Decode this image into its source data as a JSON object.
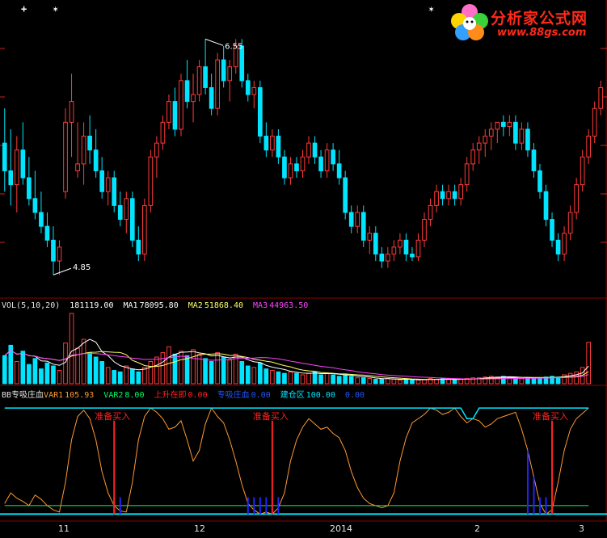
{
  "colors": {
    "up": "#ff3b3b",
    "down": "#00e5ff",
    "grid": "#8b0000",
    "ma1": "#ffffff",
    "ma2": "#ffff66",
    "ma3": "#ff44ff",
    "var1": "#ff9933",
    "var2": "#00ff66",
    "rise": "#ff2222",
    "absorb": "#2222ff",
    "build": "#00e5ff",
    "white": "#ffffff"
  },
  "logo": {
    "title": "分析家公式网",
    "url": "www.88gs.com"
  },
  "markers": {
    "cross": "+",
    "star": "✶"
  },
  "vol_legend": {
    "name": "VOL(5,10,20)",
    "vol": "181119.00",
    "ma1_label": "MA1",
    "ma1_value": "78095.80",
    "ma2_label": "MA2",
    "ma2_value": "51868.40",
    "ma3_label": "MA3",
    "ma3_value": "44963.50"
  },
  "ind_legend": {
    "name": "BB专吸庄血",
    "var1_label": "VAR1",
    "var1_value": "105.93",
    "var2_label": "VAR2",
    "var2_value": "8.00",
    "rise_label": "上升在即",
    "rise_value": "0.00",
    "absorb_label": "专吸庄血",
    "absorb_value": "0.00",
    "build_label": "建仓区",
    "build_value": "100.00",
    "extra_value": "0.00"
  },
  "signal_text": "准备买入",
  "chart_data": [
    {
      "type": "candlestick",
      "title": "",
      "annotations": [
        "6.55",
        "4.85"
      ],
      "high_label": "6.55",
      "low_label": "4.85",
      "ylim": [
        4.7,
        6.75
      ],
      "x_ticks": [
        "11",
        "12",
        "2014",
        "2",
        "3"
      ],
      "candles": [
        [
          5.8,
          6.05,
          5.45,
          5.6
        ],
        [
          5.6,
          5.9,
          5.35,
          5.5
        ],
        [
          5.5,
          5.85,
          5.3,
          5.75
        ],
        [
          5.75,
          5.95,
          5.5,
          5.55
        ],
        [
          5.55,
          5.7,
          5.35,
          5.4
        ],
        [
          5.4,
          5.6,
          5.25,
          5.3
        ],
        [
          5.3,
          5.45,
          5.15,
          5.2
        ],
        [
          5.2,
          5.3,
          5.05,
          5.1
        ],
        [
          5.1,
          5.2,
          4.85,
          4.95
        ],
        [
          4.95,
          5.1,
          4.85,
          5.05
        ],
        [
          5.45,
          6.05,
          5.4,
          5.95
        ],
        [
          5.95,
          6.3,
          5.7,
          6.1
        ],
        [
          5.6,
          5.95,
          5.55,
          5.65
        ],
        [
          5.65,
          5.95,
          5.5,
          5.85
        ],
        [
          5.85,
          6.0,
          5.65,
          5.75
        ],
        [
          5.75,
          5.9,
          5.55,
          5.6
        ],
        [
          5.6,
          5.7,
          5.4,
          5.45
        ],
        [
          5.45,
          5.6,
          5.35,
          5.55
        ],
        [
          5.55,
          5.6,
          5.3,
          5.35
        ],
        [
          5.35,
          5.45,
          5.2,
          5.25
        ],
        [
          5.25,
          5.45,
          5.15,
          5.4
        ],
        [
          5.4,
          5.45,
          5.05,
          5.1
        ],
        [
          5.1,
          5.2,
          4.95,
          5.0
        ],
        [
          5.0,
          5.4,
          4.95,
          5.35
        ],
        [
          5.35,
          5.75,
          5.3,
          5.7
        ],
        [
          5.7,
          5.85,
          5.55,
          5.8
        ],
        [
          5.8,
          6.0,
          5.75,
          5.95
        ],
        [
          5.95,
          6.15,
          5.9,
          6.1
        ],
        [
          6.1,
          6.2,
          5.85,
          5.9
        ],
        [
          5.9,
          6.3,
          5.85,
          6.25
        ],
        [
          6.25,
          6.4,
          6.05,
          6.1
        ],
        [
          6.1,
          6.3,
          5.95,
          6.15
        ],
        [
          6.15,
          6.4,
          6.1,
          6.35
        ],
        [
          6.35,
          6.55,
          6.15,
          6.2
        ],
        [
          6.2,
          6.3,
          6.0,
          6.05
        ],
        [
          6.05,
          6.45,
          6.0,
          6.4
        ],
        [
          6.4,
          6.5,
          6.2,
          6.25
        ],
        [
          6.25,
          6.4,
          6.1,
          6.35
        ],
        [
          6.35,
          6.55,
          6.3,
          6.5
        ],
        [
          6.5,
          6.55,
          6.2,
          6.25
        ],
        [
          6.25,
          6.3,
          6.1,
          6.15
        ],
        [
          6.15,
          6.25,
          6.05,
          6.2
        ],
        [
          6.2,
          6.25,
          5.8,
          5.85
        ],
        [
          5.85,
          5.95,
          5.7,
          5.75
        ],
        [
          5.75,
          5.9,
          5.7,
          5.85
        ],
        [
          5.85,
          5.9,
          5.65,
          5.7
        ],
        [
          5.7,
          5.75,
          5.5,
          5.55
        ],
        [
          5.55,
          5.7,
          5.5,
          5.65
        ],
        [
          5.65,
          5.7,
          5.55,
          5.6
        ],
        [
          5.6,
          5.75,
          5.55,
          5.7
        ],
        [
          5.7,
          5.85,
          5.65,
          5.8
        ],
        [
          5.8,
          5.85,
          5.65,
          5.7
        ],
        [
          5.7,
          5.75,
          5.55,
          5.6
        ],
        [
          5.6,
          5.8,
          5.55,
          5.75
        ],
        [
          5.75,
          5.8,
          5.6,
          5.65
        ],
        [
          5.65,
          5.75,
          5.5,
          5.55
        ],
        [
          5.55,
          5.6,
          5.25,
          5.3
        ],
        [
          5.3,
          5.35,
          5.15,
          5.2
        ],
        [
          5.2,
          5.35,
          5.15,
          5.3
        ],
        [
          5.3,
          5.35,
          5.05,
          5.1
        ],
        [
          5.1,
          5.2,
          5.0,
          5.15
        ],
        [
          5.15,
          5.2,
          4.95,
          5.0
        ],
        [
          5.0,
          5.05,
          4.9,
          4.95
        ],
        [
          4.95,
          5.05,
          4.9,
          5.0
        ],
        [
          5.0,
          5.1,
          4.95,
          5.05
        ],
        [
          5.05,
          5.15,
          5.0,
          5.1
        ],
        [
          5.1,
          5.15,
          4.95,
          5.0
        ],
        [
          5.0,
          5.05,
          4.95,
          4.98
        ],
        [
          4.98,
          5.15,
          4.95,
          5.1
        ],
        [
          5.1,
          5.3,
          5.05,
          5.25
        ],
        [
          5.25,
          5.4,
          5.2,
          5.35
        ],
        [
          5.35,
          5.5,
          5.3,
          5.45
        ],
        [
          5.45,
          5.5,
          5.35,
          5.4
        ],
        [
          5.4,
          5.5,
          5.35,
          5.45
        ],
        [
          5.45,
          5.5,
          5.35,
          5.4
        ],
        [
          5.4,
          5.55,
          5.35,
          5.5
        ],
        [
          5.5,
          5.7,
          5.45,
          5.65
        ],
        [
          5.65,
          5.8,
          5.6,
          5.75
        ],
        [
          5.75,
          5.85,
          5.65,
          5.8
        ],
        [
          5.8,
          5.9,
          5.7,
          5.85
        ],
        [
          5.85,
          5.95,
          5.75,
          5.9
        ],
        [
          5.9,
          5.95,
          5.8,
          5.95
        ],
        [
          5.95,
          6.0,
          5.85,
          5.92
        ],
        [
          5.92,
          6.0,
          5.85,
          5.95
        ],
        [
          5.95,
          6.0,
          5.75,
          5.8
        ],
        [
          5.8,
          5.95,
          5.75,
          5.9
        ],
        [
          5.9,
          5.95,
          5.7,
          5.75
        ],
        [
          5.75,
          5.8,
          5.55,
          5.6
        ],
        [
          5.6,
          5.65,
          5.4,
          5.45
        ],
        [
          5.45,
          5.5,
          5.2,
          5.25
        ],
        [
          5.25,
          5.3,
          5.05,
          5.1
        ],
        [
          5.1,
          5.15,
          4.95,
          5.0
        ],
        [
          5.0,
          5.2,
          4.95,
          5.15
        ],
        [
          5.15,
          5.35,
          5.1,
          5.3
        ],
        [
          5.3,
          5.55,
          5.25,
          5.5
        ],
        [
          5.5,
          5.75,
          5.45,
          5.7
        ],
        [
          5.7,
          5.9,
          5.65,
          5.85
        ],
        [
          5.85,
          6.1,
          5.8,
          6.05
        ],
        [
          6.05,
          6.25,
          6.0,
          6.2
        ]
      ]
    },
    {
      "type": "bar",
      "title": "VOL(5,10,20)",
      "series": [
        {
          "name": "VOL",
          "values": [
            38,
            52,
            30,
            44,
            26,
            34,
            20,
            28,
            24,
            18,
            55,
            95,
            48,
            60,
            42,
            36,
            30,
            22,
            18,
            16,
            24,
            20,
            16,
            22,
            30,
            36,
            42,
            50,
            40,
            44,
            38,
            46,
            40,
            34,
            30,
            42,
            36,
            32,
            40,
            30,
            24,
            22,
            28,
            20,
            18,
            16,
            14,
            16,
            14,
            12,
            14,
            16,
            12,
            14,
            12,
            10,
            12,
            10,
            8,
            8,
            7,
            6,
            6,
            7,
            6,
            5,
            6,
            5,
            5,
            6,
            7,
            6,
            7,
            6,
            5,
            6,
            7,
            8,
            8,
            9,
            10,
            9,
            10,
            9,
            8,
            7,
            8,
            7,
            8,
            9,
            10,
            9,
            12,
            14,
            16,
            22,
            56
          ]
        }
      ]
    },
    {
      "type": "line",
      "title": "BB专吸庄血",
      "ylim": [
        -5,
        110
      ],
      "series": [
        {
          "name": "VAR1",
          "values": [
            10,
            20,
            15,
            12,
            8,
            18,
            14,
            8,
            4,
            2,
            30,
            70,
            92,
            98,
            90,
            70,
            40,
            20,
            8,
            3,
            2,
            30,
            70,
            92,
            100,
            96,
            90,
            80,
            82,
            88,
            70,
            50,
            60,
            85,
            100,
            92,
            86,
            70,
            50,
            28,
            10,
            4,
            0,
            2,
            0,
            6,
            20,
            50,
            70,
            82,
            90,
            85,
            80,
            82,
            76,
            72,
            60,
            40,
            25,
            15,
            10,
            8,
            6,
            8,
            20,
            50,
            72,
            86,
            90,
            94,
            100,
            98,
            94,
            96,
            100,
            92,
            86,
            90,
            88,
            82,
            85,
            90,
            92,
            94,
            96,
            80,
            60,
            35,
            10,
            0,
            4,
            30,
            60,
            80,
            90,
            95,
            100
          ]
        },
        {
          "name": "VAR2",
          "values": [
            8,
            8,
            8,
            8,
            8,
            8,
            8,
            8,
            8,
            8,
            8,
            8,
            8,
            8,
            8,
            8,
            8,
            8,
            8,
            8,
            8,
            8,
            8,
            8,
            8,
            8,
            8,
            8,
            8,
            8,
            8,
            8,
            8,
            8,
            8,
            8,
            8,
            8,
            8,
            8,
            8,
            8,
            8,
            8,
            8,
            8,
            8,
            8,
            8,
            8,
            8,
            8,
            8,
            8,
            8,
            8,
            8,
            8,
            8,
            8,
            8,
            8,
            8,
            8,
            8,
            8,
            8,
            8,
            8,
            8,
            8,
            8,
            8,
            8,
            8,
            8,
            8,
            8,
            8,
            8,
            8,
            8,
            8,
            8,
            8,
            8,
            8,
            8,
            8,
            8,
            8,
            8,
            8,
            8,
            8,
            8,
            8
          ]
        },
        {
          "name": "建仓区",
          "values": [
            100,
            100,
            100,
            100,
            100,
            100,
            100,
            100,
            100,
            100,
            100,
            100,
            100,
            100,
            100,
            100,
            100,
            100,
            100,
            100,
            100,
            100,
            100,
            100,
            100,
            100,
            100,
            100,
            100,
            100,
            100,
            100,
            100,
            100,
            100,
            100,
            100,
            100,
            100,
            100,
            100,
            100,
            100,
            100,
            100,
            100,
            100,
            100,
            100,
            100,
            100,
            100,
            100,
            100,
            100,
            100,
            100,
            100,
            100,
            100,
            100,
            100,
            100,
            100,
            100,
            100,
            100,
            100,
            100,
            100,
            100,
            100,
            100,
            100,
            100,
            100,
            90,
            90,
            100,
            100,
            100,
            100,
            100,
            100,
            100,
            100,
            100,
            100,
            100,
            100,
            100,
            100,
            100,
            100,
            100,
            100,
            100
          ]
        }
      ],
      "signals": [
        18,
        44,
        90
      ],
      "absorb_bars": [
        [
          18,
          19
        ],
        [
          40,
          41,
          42,
          43,
          44,
          45
        ],
        [
          86,
          87,
          88,
          89,
          90
        ]
      ]
    }
  ]
}
